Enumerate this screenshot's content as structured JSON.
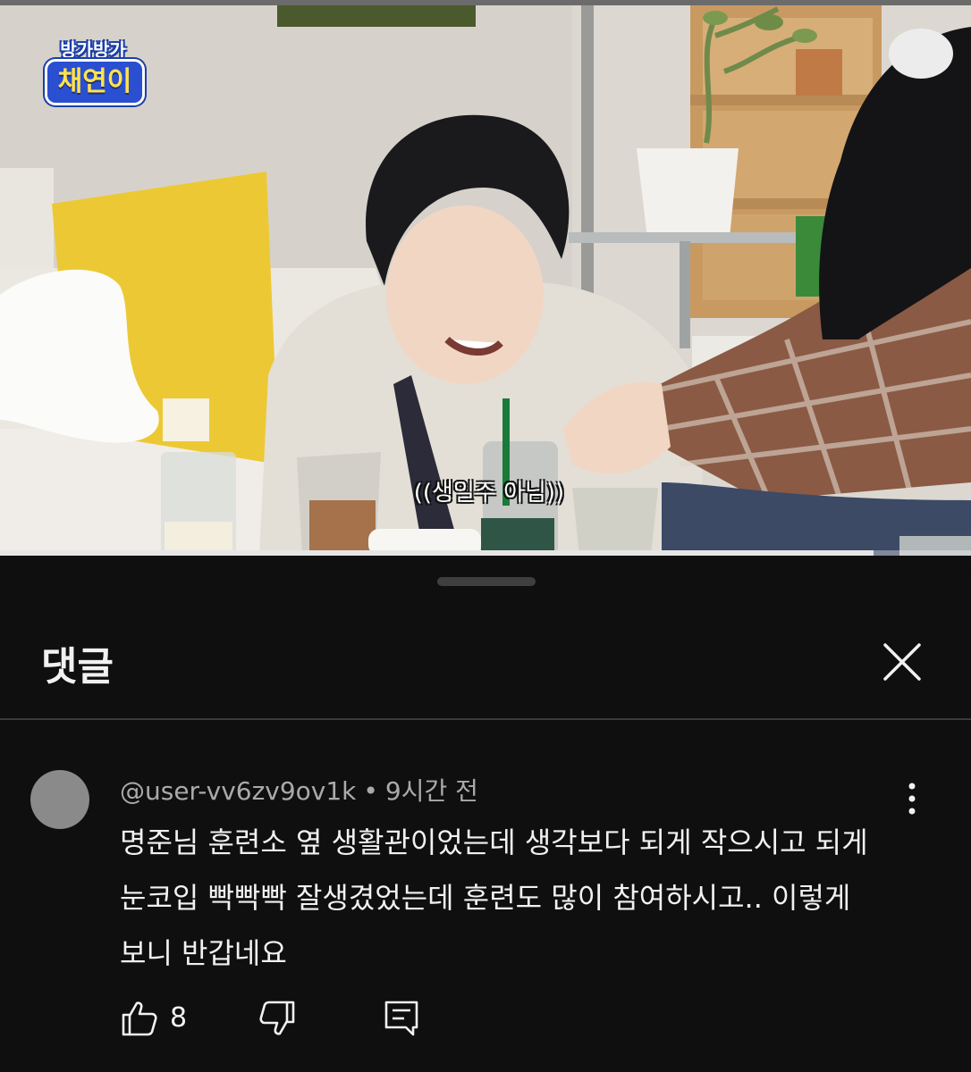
{
  "video": {
    "channel_logo_line1": "방가방가",
    "channel_logo_line2": "채연이",
    "caption": "((생일주 아님))",
    "progress": 0.9
  },
  "comments_panel": {
    "title": "댓글",
    "close_icon": "close-icon"
  },
  "comment": {
    "author": "@user-vv6zv9ov1k",
    "separator": "•",
    "time": "9시간 전",
    "text": "명준님 훈련소 옆 생활관이었는데 생각보다 되게 작으시고 되게 눈코입 빡빡빡 잘생겼었는데 훈련도 많이 참여하시고.. 이렇게 보니 반갑네요",
    "likes": "8",
    "icons": {
      "more": "more-vert-icon",
      "like": "thumbs-up-icon",
      "dislike": "thumbs-down-icon",
      "reply": "reply-icon"
    }
  }
}
